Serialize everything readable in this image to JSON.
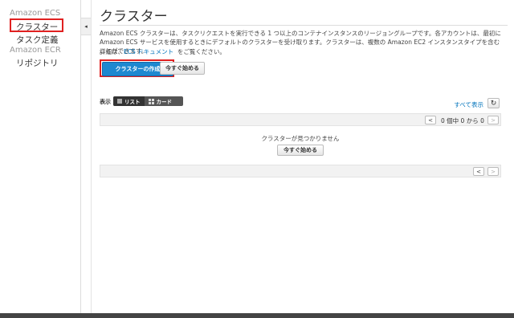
{
  "sidebar": {
    "sections": [
      {
        "heading": "Amazon ECS",
        "items": [
          "クラスター",
          "タスク定義"
        ]
      },
      {
        "heading": "Amazon ECR",
        "items": [
          "リポジトリ"
        ]
      }
    ],
    "selected_item": "クラスター",
    "collapse_glyph": "◂"
  },
  "page": {
    "title": "クラスター",
    "description": "Amazon ECS クラスターは、タスクリクエストを実行できる 1 つ以上のコンテナインスタンスのリージョングループです。各アカウントは、最初に Amazon ECS サービスを使用するときにデフォルトのクラスターを受け取ります。クラスターは、複数の Amazon EC2 インスタンスタイプを含むことができます。",
    "details_prefix": "詳細は、",
    "details_link": "ECS ドキュメント",
    "details_suffix": "をご覧ください。",
    "create_button": "クラスターの作成",
    "get_started_button": "今すぐ始める"
  },
  "toolbar": {
    "view_label": "表示",
    "view_list": "リスト",
    "view_card": "カード",
    "show_all": "すべて表示",
    "refresh_glyph": "↻"
  },
  "pagination": {
    "prev": "<",
    "next": ">",
    "count_text": "0 個中 0 から 0"
  },
  "empty_state": {
    "message": "クラスターが見つかりません",
    "button": "今すぐ始める"
  },
  "colors": {
    "primary": "#1e88d0",
    "link": "#0073bb",
    "highlight_box": "#e02020"
  }
}
